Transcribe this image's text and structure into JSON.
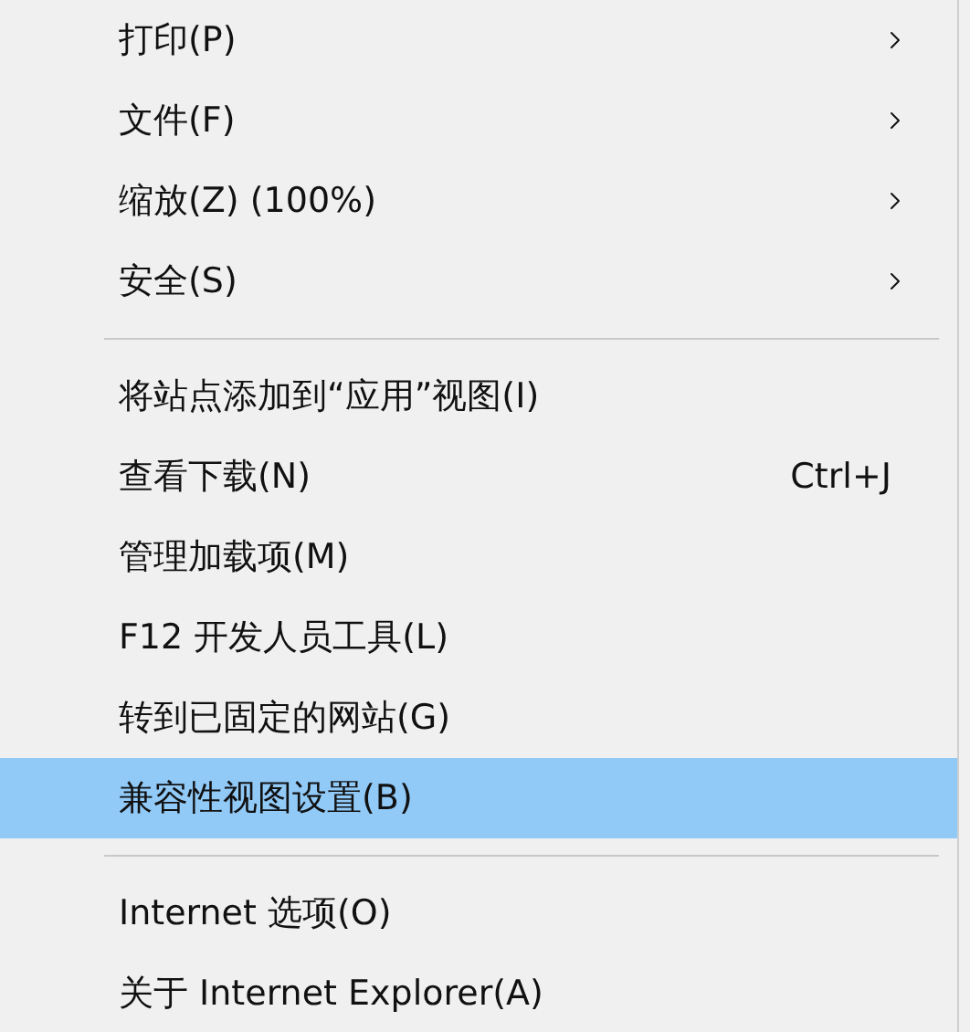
{
  "menu": {
    "groups": [
      {
        "items": [
          {
            "label": "打印(P)",
            "submenu": true,
            "selected": false
          },
          {
            "label": "文件(F)",
            "submenu": true,
            "selected": false
          },
          {
            "label": "缩放(Z) (100%)",
            "submenu": true,
            "selected": false
          },
          {
            "label": "安全(S)",
            "submenu": true,
            "selected": false
          }
        ]
      },
      {
        "items": [
          {
            "label": "将站点添加到“应用”视图(I)",
            "submenu": false,
            "selected": false
          },
          {
            "label": "查看下载(N)",
            "shortcut": "Ctrl+J",
            "submenu": false,
            "selected": false
          },
          {
            "label": "管理加载项(M)",
            "submenu": false,
            "selected": false
          },
          {
            "label": "F12 开发人员工具(L)",
            "submenu": false,
            "selected": false
          },
          {
            "label": "转到已固定的网站(G)",
            "submenu": false,
            "selected": false
          },
          {
            "label": "兼容性视图设置(B)",
            "submenu": false,
            "selected": true
          }
        ]
      },
      {
        "items": [
          {
            "label": "Internet 选项(O)",
            "submenu": false,
            "selected": false
          },
          {
            "label": "关于 Internet Explorer(A)",
            "submenu": false,
            "selected": false
          }
        ]
      }
    ]
  }
}
